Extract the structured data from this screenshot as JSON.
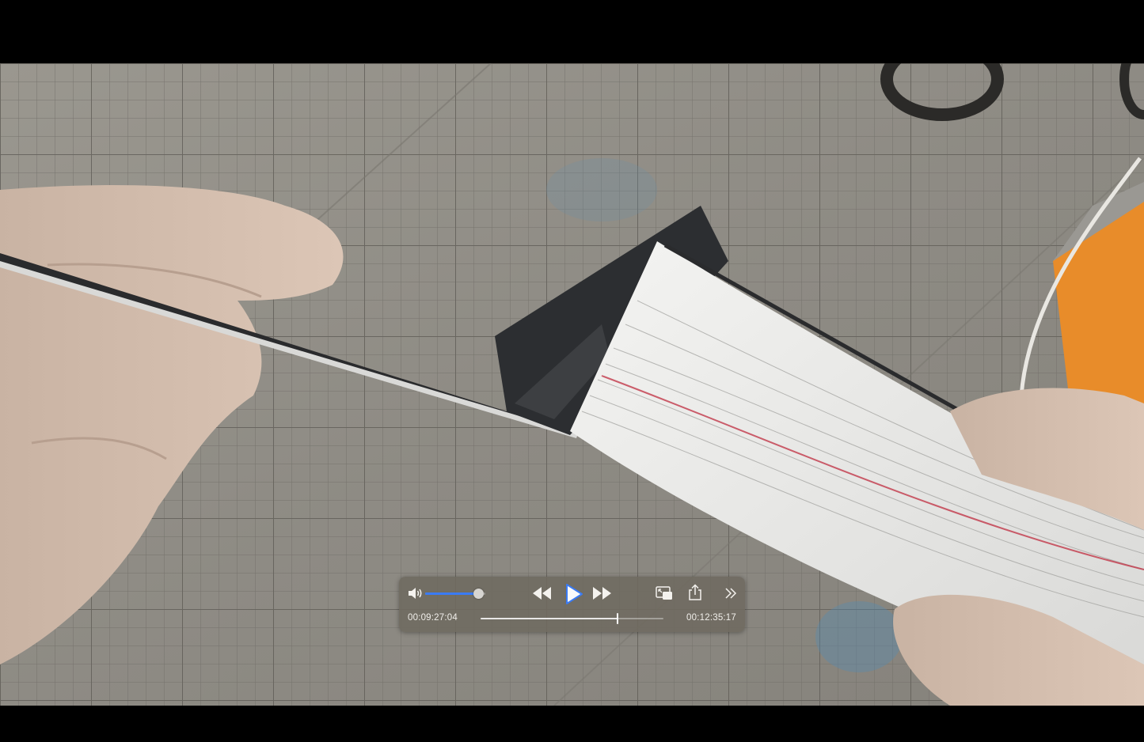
{
  "player": {
    "elapsed_time": "00:09:27:04",
    "total_time": "00:12:35:17",
    "playback_progress": 0.747,
    "volume_level": 0.88,
    "state": "paused",
    "accent_color": "#3a7bf4"
  },
  "icons": {
    "volume": "speaker-volume-icon",
    "rewind": "rewind-icon",
    "play": "play-icon",
    "forward": "fast-forward-icon",
    "pip": "picture-in-picture-icon",
    "share": "share-icon",
    "more": "chevron-double-right-icon"
  }
}
